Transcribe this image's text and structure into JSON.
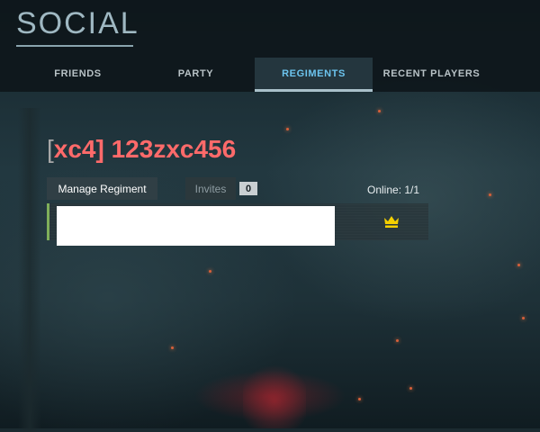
{
  "header": {
    "title": "SOCIAL",
    "tabs": [
      {
        "label": "FRIENDS",
        "active": false
      },
      {
        "label": "PARTY",
        "active": false
      },
      {
        "label": "REGIMENTS",
        "active": true
      },
      {
        "label": "RECENT PLAYERS",
        "active": false
      }
    ]
  },
  "regiment": {
    "bracket_open": "[",
    "tag": "xc4",
    "bracket_close": "]",
    "name": "123zxc456",
    "manage_label": "Manage Regiment",
    "invites_label": "Invites",
    "invites_count": "0",
    "online": "Online: 1/1"
  },
  "members": [
    {
      "name": "",
      "role_icon": "crown-icon"
    }
  ],
  "colors": {
    "regiment_name": "#ff6a6a",
    "active_tab": "#6cc4ee",
    "online_accent": "#7faf5a",
    "crown": "#f5d000"
  }
}
